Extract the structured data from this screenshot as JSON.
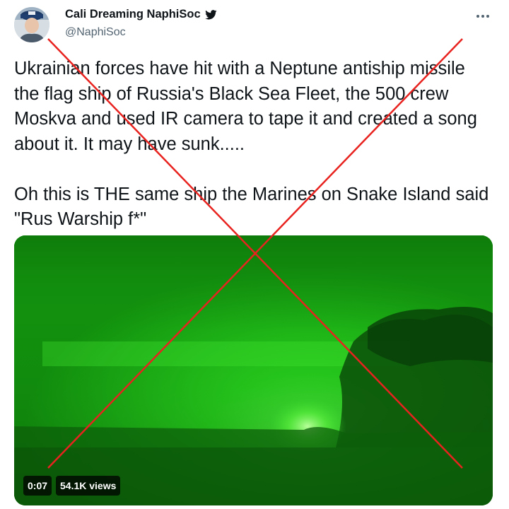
{
  "author": {
    "display_name": "Cali Dreaming NaphiSoc",
    "handle": "@NaphiSoc",
    "verified_icon": "twitter-bird-icon",
    "avatar_icon": "profile-photo"
  },
  "more_icon": "more-options-icon",
  "tweet": {
    "text": "Ukrainian forces have hit with a Neptune antiship missile the flag ship of Russia's Black Sea Fleet, the 500 crew Moskva and used IR camera to tape it and created a song about it. It may have sunk.....\n\nOh this is THE same ship the Marines on Snake Island said \"Rus Warship f*\""
  },
  "video": {
    "duration": "0:07",
    "views": "54.1K views"
  },
  "overlay": {
    "type": "red-x-cross-out",
    "color": "#e8231f"
  },
  "colors": {
    "accent": "#1d9bf0",
    "night_vision_green": "#1fc21a"
  }
}
